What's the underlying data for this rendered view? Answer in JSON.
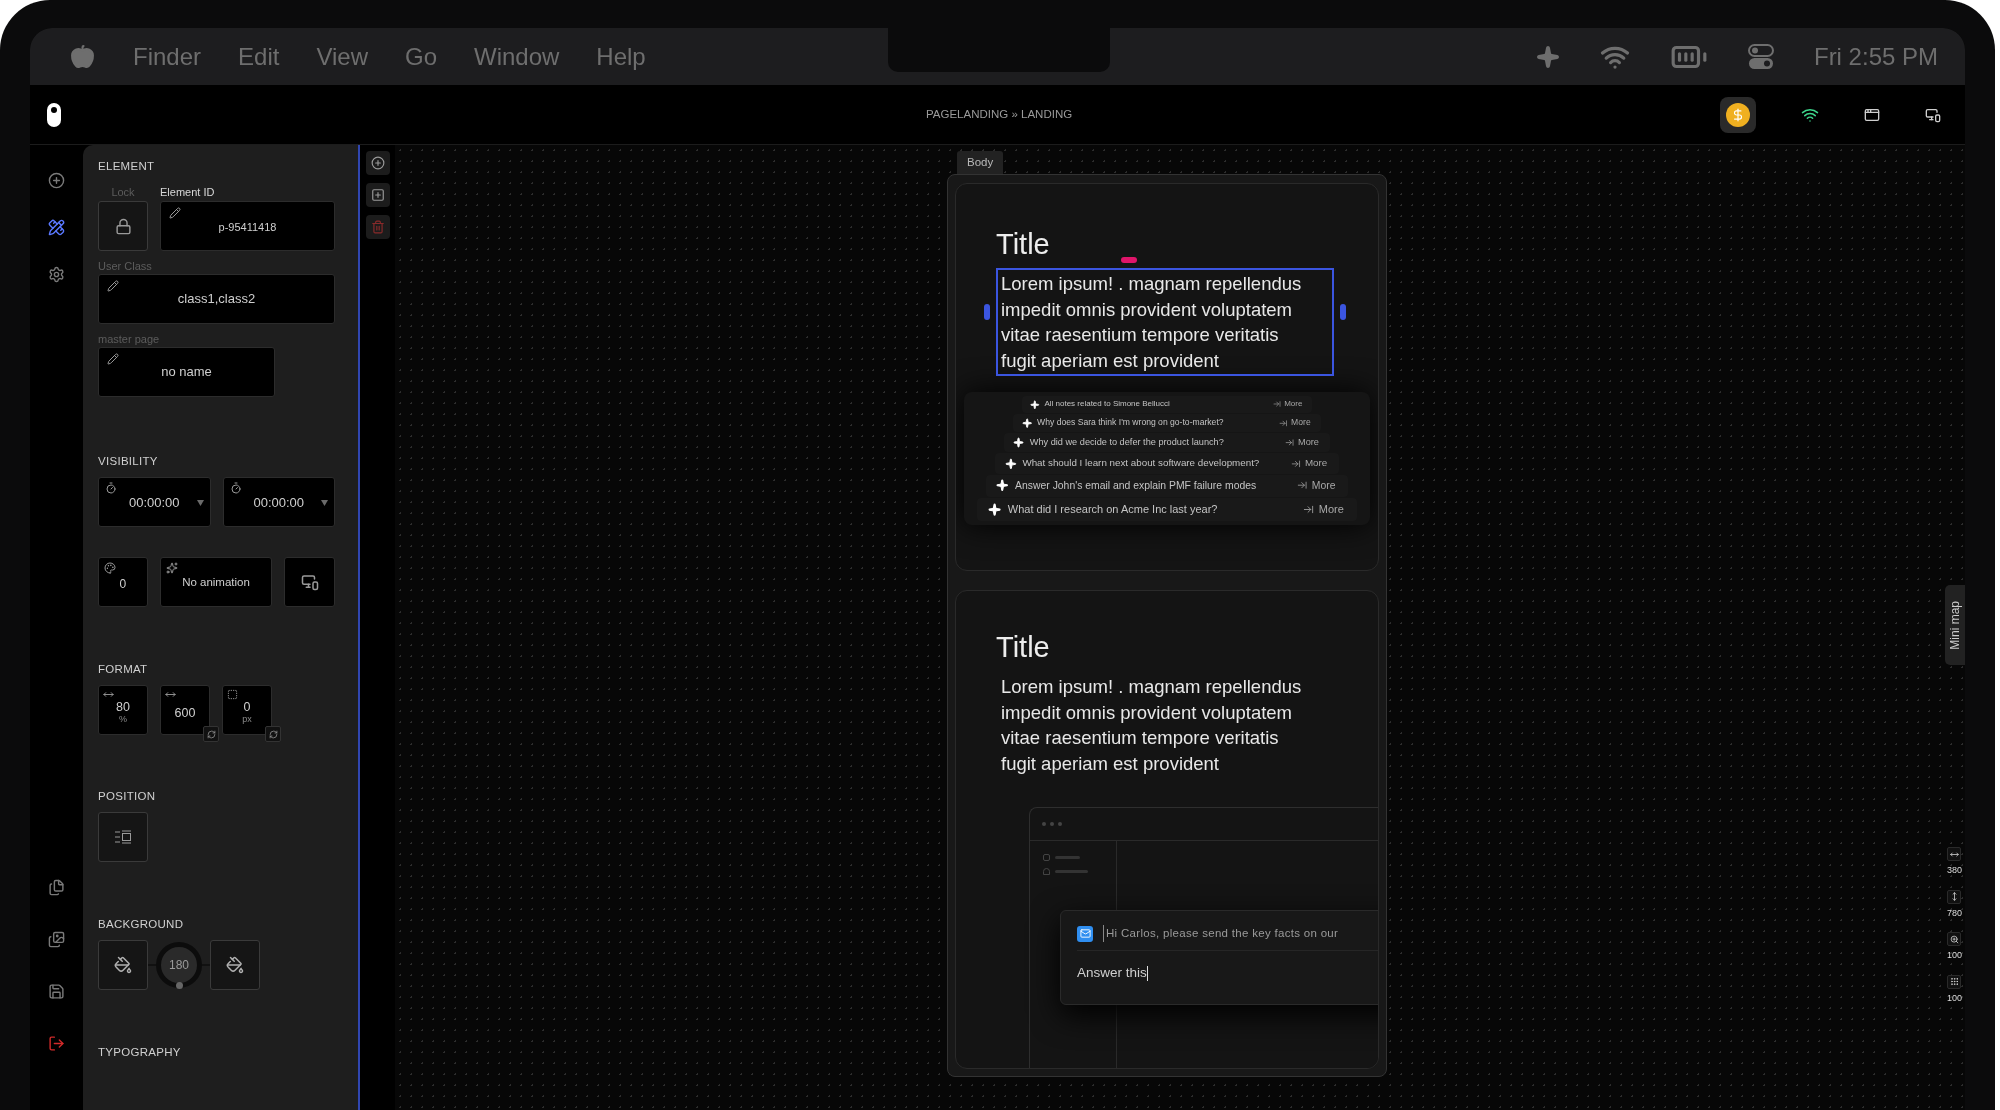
{
  "menu_bar": {
    "items": [
      "Finder",
      "Edit",
      "View",
      "Go",
      "Window",
      "Help"
    ],
    "clock": "Fri 2:55 PM"
  },
  "header": {
    "breadcrumb": "PAGELANDING » LANDING"
  },
  "rail": {
    "top": [
      {
        "selected": false
      },
      {
        "selected": true
      },
      {
        "selected": false
      }
    ]
  },
  "panel": {
    "element": {
      "heading": "ELEMENT",
      "lock_label": "Lock",
      "id_label": "Element ID",
      "id_value": "p-95411418",
      "user_class_label": "User Class",
      "user_class_value": "class1,class2",
      "master_label": "master page",
      "master_value": "no name"
    },
    "visibility": {
      "heading": "VISIBILITY",
      "start": "00:00:00",
      "end": "00:00:00",
      "delay": "0",
      "animation": "No animation"
    },
    "format": {
      "heading": "FORMAT",
      "fields": [
        {
          "kind": "width",
          "value": "80",
          "unit": "%",
          "reset": false
        },
        {
          "kind": "width",
          "value": "600",
          "reset": true
        },
        {
          "kind": "radius",
          "value": "0",
          "unit": "px",
          "reset": true
        }
      ]
    },
    "position": {
      "heading": "POSITION"
    },
    "background": {
      "heading": "BACKGROUND",
      "angle": "180"
    },
    "typography": {
      "heading": "TYPOGRAPHY"
    }
  },
  "canvas": {
    "frame_label": "Body",
    "sections": [
      {
        "title": "Title",
        "text": "Lorem ipsum! . magnam repellendus impedit omnis provident voluptatem vitae raesentium tempore veritatis fugit aperiam est provident",
        "selected": true,
        "suggestions": [
          {
            "text": "All notes related to Simone Bellucci",
            "action": "More"
          },
          {
            "text": "Why does Sara think I'm wrong on go-to-market?",
            "action": "More"
          },
          {
            "text": "Why did we decide to defer the product launch?",
            "action": "More"
          },
          {
            "text": "What should I learn next about software development?",
            "action": "More"
          },
          {
            "text": "Answer John's email and explain PMF failure modes",
            "action": "More"
          },
          {
            "text": "What did I research on Acme Inc last year?",
            "action": "More"
          }
        ]
      },
      {
        "title": "Title",
        "text": "Lorem ipsum! . magnam repellendus impedit omnis provident voluptatem vitae raesentium tempore veritatis fugit aperiam est provident",
        "selected": false,
        "compose": {
          "message": "Hi Carlos, please send the key facts on our",
          "reply": "Answer this"
        }
      }
    ]
  },
  "mini_map": {
    "label": "Mini map"
  },
  "view_controls": [
    {
      "kind": "width",
      "value": "380"
    },
    {
      "kind": "height",
      "value": "780"
    },
    {
      "kind": "zoom",
      "value": "100"
    },
    {
      "kind": "grid",
      "value": "100"
    }
  ]
}
